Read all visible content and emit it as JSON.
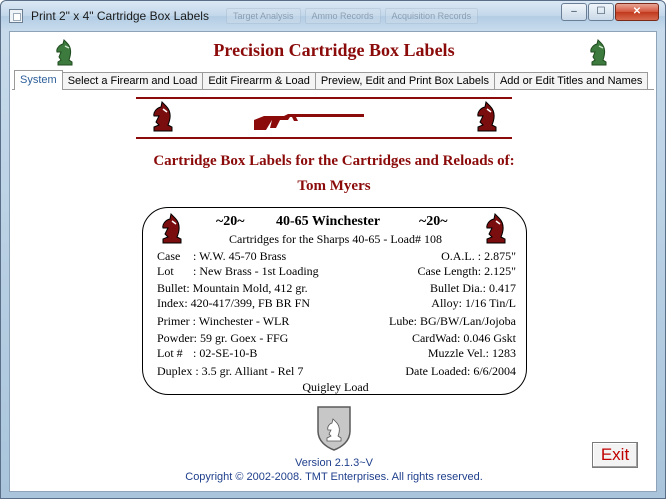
{
  "window": {
    "title": "Print 2\" x 4\" Cartridge Box Labels",
    "ghost_tabs": [
      "Target Analysis",
      "Ammo Records",
      "Acquisition Records"
    ],
    "controls": {
      "minimize": "–",
      "maximize": "☐",
      "close": "✕"
    }
  },
  "header": {
    "title": "Precision Cartridge Box Labels"
  },
  "tabs": [
    {
      "label": "System",
      "active": true
    },
    {
      "label": "Select a Firearm and Load",
      "active": false
    },
    {
      "label": "Edit Firearrm & Load",
      "active": false
    },
    {
      "label": "Preview, Edit and Print Box Labels",
      "active": false
    },
    {
      "label": "Add or Edit Titles and Names",
      "active": false
    }
  ],
  "main": {
    "heading": "Cartridge Box Labels for the Cartridges and Reloads of:",
    "owner": "Tom Myers"
  },
  "label": {
    "left_tilde": "~20~",
    "cartridge": "40-65 Winchester",
    "right_tilde": "~20~",
    "subtitle": "Cartridges for the Sharps 40-65 - Load# 108",
    "case_label": "Case",
    "case_value": ": W.W. 45-70 Brass",
    "oal": "O.A.L. :  2.875\"",
    "lot_label": "Lot",
    "lot_value": ": New Brass - 1st Loading",
    "case_length": "Case Length:  2.125\"",
    "bullet": "Bullet: Mountain Mold, 412 gr.",
    "bullet_dia": "Bullet Dia.:  0.417",
    "index": "Index: 420-417/399, FB BR FN",
    "alloy": "Alloy:  1/16 Tin/L",
    "primer": "Primer : Winchester - WLR",
    "lube": "Lube:  BG/BW/Lan/Jojoba",
    "powder": "Powder: 59 gr.  Goex - FFG",
    "cardwad": "CardWad:  0.046 Gskt",
    "lot_num_label": "Lot #",
    "lot_num_value": ": 02-SE-10-B",
    "muzzle_vel": "Muzzle Vel.:  1283",
    "duplex": "Duplex : 3.5 gr. Alliant - Rel 7",
    "date_loaded": "Date Loaded:  6/6/2004",
    "footer": "Quigley Load"
  },
  "footer": {
    "version": "Version 2.1.3~V",
    "copyright": "Copyright © 2002-2008. TMT Enterprises. All rights reserved.",
    "exit_label": "Exit"
  },
  "colors": {
    "brand": "#8b0a0a",
    "link_blue": "#1f3f8c",
    "tab_active": "#2d5f9a",
    "exit_red": "#c00000"
  }
}
